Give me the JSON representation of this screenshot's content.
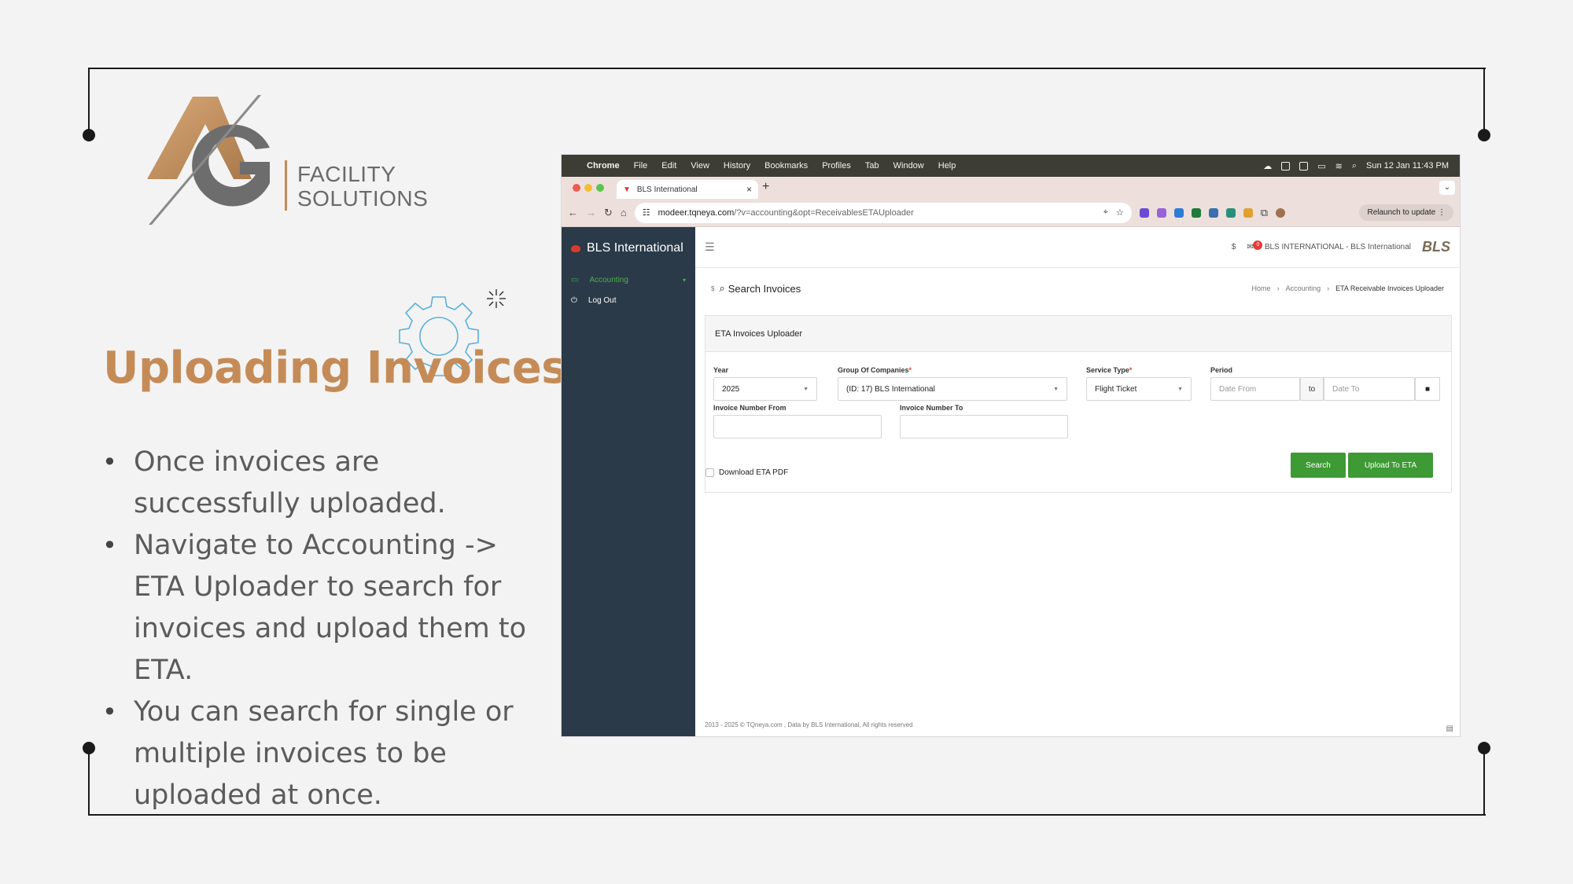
{
  "slide": {
    "logo_line1": "FACILITY",
    "logo_line2": "SOLUTIONS",
    "title": "Uploading Invoices",
    "bullets": [
      "Once invoices are successfully uploaded.",
      "Navigate to Accounting -> ETA Uploader to search for invoices and upload them to ETA.",
      "You can search for single or multiple invoices to be uploaded at once."
    ],
    "colors": {
      "accent": "#c58b57",
      "frame": "#1a1a1a",
      "background": "#f3f3f3"
    }
  },
  "mac_menu": {
    "app": "Chrome",
    "items": [
      "File",
      "Edit",
      "View",
      "History",
      "Bookmarks",
      "Profiles",
      "Tab",
      "Window",
      "Help"
    ],
    "clock": "Sun 12 Jan  11:43 PM"
  },
  "browser": {
    "tab_title": "BLS International",
    "url_host": "modeer.tqneya.com",
    "url_rest": "/?v=accounting&opt=ReceivablesETAUploader",
    "relaunch_label": "Relaunch to update"
  },
  "app": {
    "brand": "BLS International",
    "sidebar": [
      {
        "label": "Accounting",
        "icon": "card-icon"
      },
      {
        "label": "Log Out",
        "icon": "power-icon"
      }
    ],
    "topbar": {
      "currency": "$",
      "mail_count": "0",
      "company": "BLS INTERNATIONAL - BLS International",
      "logo_text": "BLS"
    },
    "page_title": "Search Invoices",
    "breadcrumb": [
      "Home",
      "Accounting",
      "ETA Receivable Invoices Uploader"
    ],
    "card_title": "ETA Invoices Uploader",
    "form": {
      "year_label": "Year",
      "year_value": "2025",
      "group_label": "Group Of Companies",
      "group_value": "(ID: 17) BLS International",
      "service_label": "Service Type",
      "service_value": "Flight Ticket",
      "period_label": "Period",
      "date_from_placeholder": "Date From",
      "to_label": "to",
      "date_to_placeholder": "Date To",
      "inv_from_label": "Invoice Number From",
      "inv_to_label": "Invoice Number To",
      "download_pdf_label": "Download ETA PDF",
      "search_label": "Search",
      "upload_label": "Upload To ETA"
    },
    "footer": "2013 - 2025 © TQneya.com , Data by BLS International, All rights reserved"
  }
}
